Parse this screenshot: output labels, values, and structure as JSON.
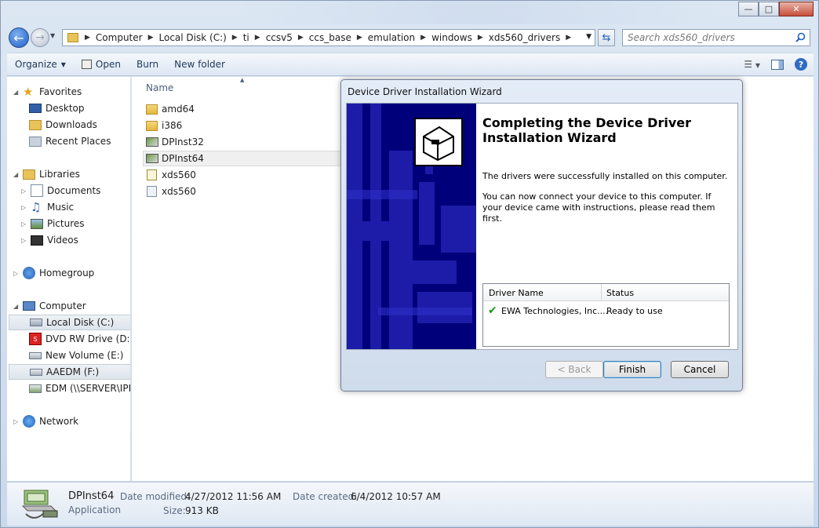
{
  "window": {
    "caption_buttons": [
      "minimize",
      "maximize",
      "close"
    ]
  },
  "address_bar": {
    "crumbs": [
      "Computer",
      "Local Disk (C:)",
      "ti",
      "ccsv5",
      "ccs_base",
      "emulation",
      "windows",
      "xds560_drivers"
    ]
  },
  "search": {
    "placeholder": "Search xds560_drivers"
  },
  "toolbar": {
    "organize": "Organize",
    "open": "Open",
    "burn": "Burn",
    "new_folder": "New folder",
    "help": "?"
  },
  "nav": {
    "favorites": "Favorites",
    "desktop": "Desktop",
    "downloads": "Downloads",
    "recent_places": "Recent Places",
    "libraries": "Libraries",
    "documents": "Documents",
    "music": "Music",
    "pictures": "Pictures",
    "videos": "Videos",
    "homegroup": "Homegroup",
    "computer": "Computer",
    "local_disk": "Local Disk (C:)",
    "dvd": "DVD RW Drive (D:) S",
    "new_volume": "New Volume (E:)",
    "aaedm": "AAEDM (F:)",
    "edm": "EDM (\\\\SERVER\\IPR",
    "network": "Network"
  },
  "files": {
    "column_name": "Name",
    "items": [
      "amd64",
      "i386",
      "DPInst32",
      "DPInst64",
      "xds560",
      "xds560"
    ]
  },
  "details": {
    "name": "DPInst64",
    "type": "Application",
    "date_modified_label": "Date modified:",
    "date_modified": "4/27/2012 11:56 AM",
    "date_created_label": "Date created:",
    "date_created": "6/4/2012 10:57 AM",
    "size_label": "Size:",
    "size": "913 KB"
  },
  "dialog": {
    "title": "Device Driver Installation Wizard",
    "heading": "Completing the Device Driver Installation Wizard",
    "para1": "The drivers were successfully installed on this computer.",
    "para2": "You can now connect your device to this computer. If your device came with instructions, please read them first.",
    "table": {
      "col_driver": "Driver Name",
      "col_status": "Status",
      "driver": "EWA Technologies, Inc....",
      "status": "Ready to use"
    },
    "buttons": {
      "back": "< Back",
      "finish": "Finish",
      "cancel": "Cancel"
    }
  },
  "colors": {
    "banner": "#00007a",
    "accent": "#1f5fbf",
    "check": "#1a9a1a"
  }
}
